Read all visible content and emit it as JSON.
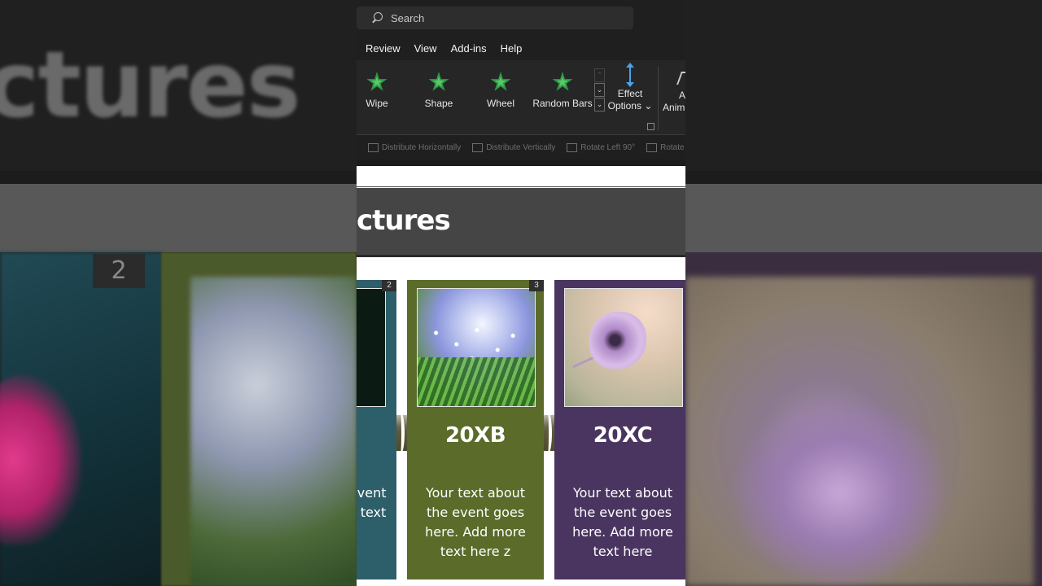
{
  "titlebar": {
    "search_placeholder": "Search"
  },
  "menu": {
    "items": [
      "Review",
      "View",
      "Add-ins",
      "Help"
    ]
  },
  "animations": {
    "items": [
      {
        "label": "Wipe"
      },
      {
        "label": "Shape"
      },
      {
        "label": "Wheel"
      },
      {
        "label": "Random Bars"
      }
    ],
    "scroll_up": "⌃",
    "scroll_down": "⌄",
    "more": "⌄",
    "effect_options_line1": "Effect",
    "effect_options_line2": "Options ⌄",
    "add_animation_line1": "A",
    "add_animation_line2": "Anim"
  },
  "arrange": {
    "distribute_horizontally": "Distribute Horizontally",
    "distribute_vertically": "Distribute Vertically",
    "rotate_left": "Rotate Left 90°",
    "rotate_right": "Rotate"
  },
  "slide": {
    "title": "ctures",
    "cards": [
      {
        "num": "2",
        "year": "",
        "text": "Your text about the event goes here. Add more text here"
      },
      {
        "num": "3",
        "year": "20XB",
        "text": "Your text about the event goes here. Add more text here z"
      },
      {
        "num": "",
        "year": "20XC",
        "text": "Your text about the event goes here. Add more text here"
      }
    ]
  },
  "background": {
    "left_word": "ctures",
    "left_num": "2"
  },
  "colors": {
    "teal_card": "#2d5f6a",
    "green_card": "#5a6b2a",
    "purple_card": "#4a3560",
    "animation_star": "#2e9a45",
    "effect_arrow": "#4aa3e8"
  }
}
